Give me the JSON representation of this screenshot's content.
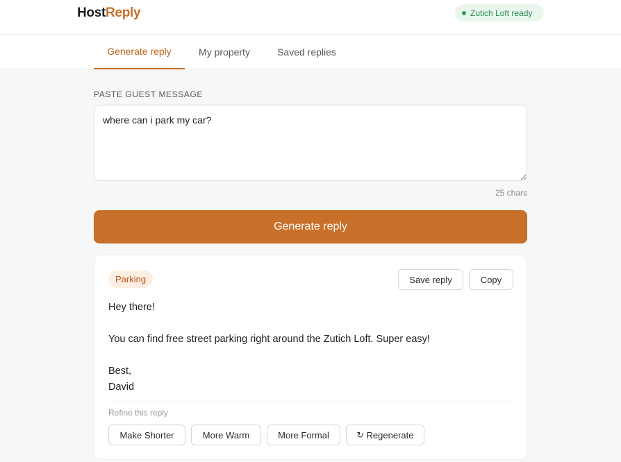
{
  "app": {
    "logo_part1": "Host",
    "logo_part2": "Reply",
    "status": "Zutich Loft ready",
    "colors": {
      "accent": "#c8702a",
      "status_green": "#2fa05a"
    }
  },
  "tabs": [
    {
      "label": "Generate reply",
      "active": true
    },
    {
      "label": "My property",
      "active": false
    },
    {
      "label": "Saved replies",
      "active": false
    }
  ],
  "composer": {
    "label": "PASTE GUEST MESSAGE",
    "message": "where can i park my car?",
    "char_count": "25 chars",
    "generate_label": "Generate reply"
  },
  "reply": {
    "category": "Parking",
    "save_label": "Save reply",
    "copy_label": "Copy",
    "greeting": "Hey there!",
    "body": "You can find free street parking right around the Zutich Loft. Super easy!",
    "signoff": "Best,",
    "signature": "David",
    "refine_label": "Refine this reply",
    "refine_actions": [
      "Make Shorter",
      "More Warm",
      "More Formal",
      "Regenerate"
    ],
    "regenerate_icon": "refresh-icon"
  }
}
